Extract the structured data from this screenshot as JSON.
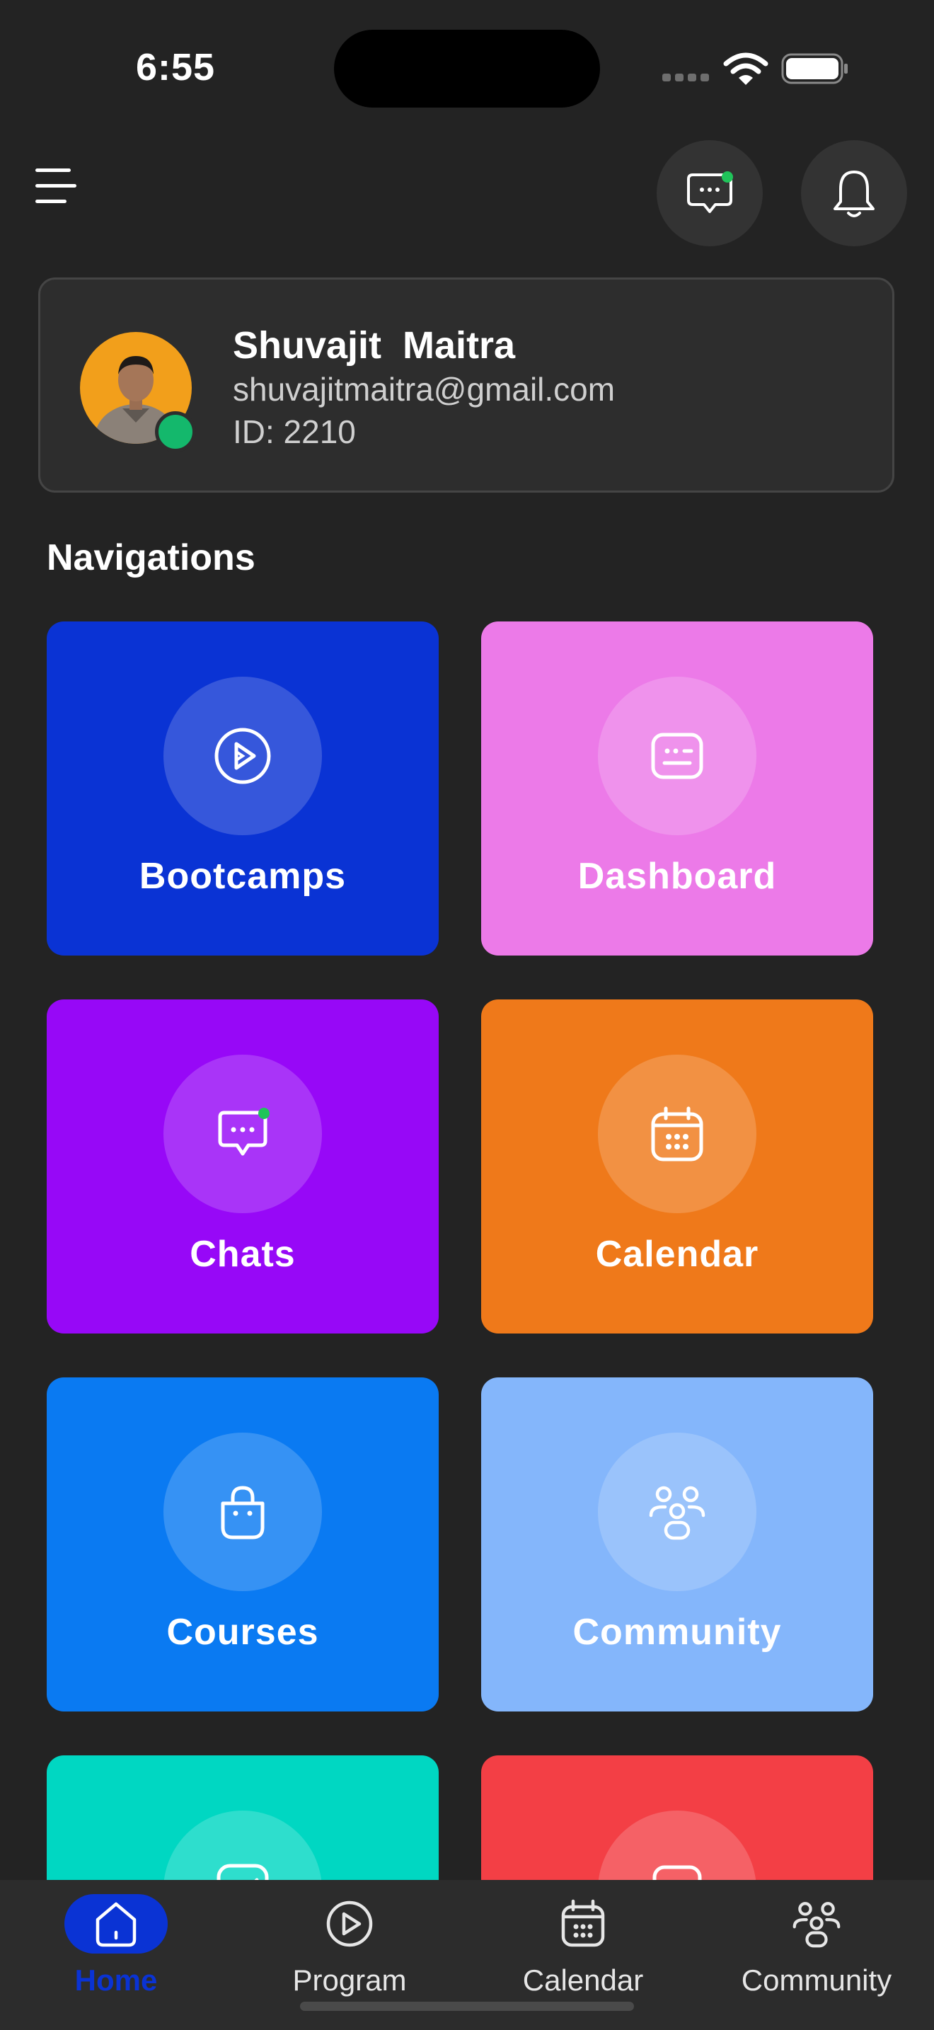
{
  "status_bar": {
    "time": "6:55"
  },
  "header": {
    "menu_icon": "hamburger-icon",
    "chat_icon": "chat-bubble-icon",
    "notification_icon": "bell-icon"
  },
  "profile": {
    "name": "Shuvajit  Maitra",
    "email": "shuvajitmaitra@gmail.com",
    "id_text": "ID: 2210",
    "avatar_bg": "#f29f1b",
    "online_color": "#14b86c"
  },
  "navigations": {
    "title": "Navigations",
    "tiles": [
      {
        "label": "Bootcamps",
        "icon": "play-circle-icon",
        "color": "#0a33d4"
      },
      {
        "label": "Dashboard",
        "icon": "dashboard-card-icon",
        "color": "#ec7ae8"
      },
      {
        "label": "Chats",
        "icon": "chat-bubble-icon",
        "color": "#9708f7"
      },
      {
        "label": "Calendar",
        "icon": "calendar-icon",
        "color": "#ef791a"
      },
      {
        "label": "Courses",
        "icon": "shopping-bag-icon",
        "color": "#0a7af2"
      },
      {
        "label": "Community",
        "icon": "community-icon",
        "color": "#84b6fb"
      },
      {
        "label": "",
        "icon": "chart-icon",
        "color": "#00d7c2"
      },
      {
        "label": "",
        "icon": "document-icon",
        "color": "#f33f45"
      }
    ]
  },
  "tabbar": {
    "accent": "#0a33d4",
    "tabs": [
      {
        "label": "Home",
        "icon": "home-icon",
        "active": true
      },
      {
        "label": "Program",
        "icon": "play-circle-icon",
        "active": false
      },
      {
        "label": "Calendar",
        "icon": "calendar-icon",
        "active": false
      },
      {
        "label": "Community",
        "icon": "community-icon",
        "active": false
      }
    ]
  }
}
